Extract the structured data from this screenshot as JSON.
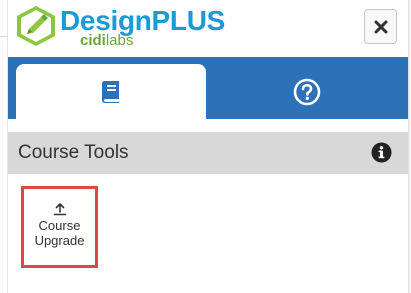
{
  "header": {
    "brand_name": "DesignPLUS",
    "sub_brand_cidi": "cidi",
    "sub_brand_labs": "labs",
    "close_icon": "close-icon"
  },
  "tabs": [
    {
      "icon": "book-icon",
      "active": true
    },
    {
      "icon": "help-circle-icon",
      "active": false
    }
  ],
  "section": {
    "title": "Course Tools",
    "info_icon": "info-icon"
  },
  "tools": [
    {
      "label_line1": "Course",
      "label_line2": "Upgrade",
      "icon": "upload-icon",
      "highlighted": true
    }
  ],
  "colors": {
    "brand_blue": "#1a9ad6",
    "brand_green": "#6aa63b",
    "tab_bar": "#2d72b8",
    "section_bar": "#d8d8d8",
    "highlight_red": "#e0474c"
  }
}
